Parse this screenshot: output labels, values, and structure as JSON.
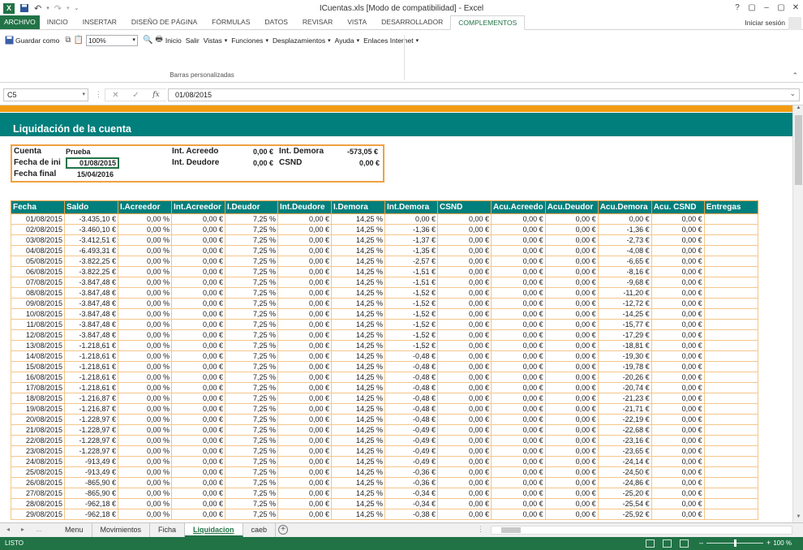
{
  "window": {
    "title": "ICuentas.xls  [Modo de compatibilidad] - Excel",
    "controls": [
      "?",
      "▢",
      "–",
      "▢",
      "✕"
    ]
  },
  "menu": {
    "tabs": [
      "ARCHIVO",
      "INICIO",
      "INSERTAR",
      "DISEÑO DE PÁGINA",
      "FÓRMULAS",
      "DATOS",
      "REVISAR",
      "VISTA",
      "DESARROLLADOR",
      "COMPLEMENTOS"
    ],
    "active_tab": "COMPLEMENTOS",
    "signin": "Iniciar sesión"
  },
  "ribbon": {
    "guardar": "Guardar como",
    "zoom": "100%",
    "inicio": "Inicio",
    "salir": "Salir",
    "vistas": "Vistas",
    "funciones": "Funciones",
    "desplazamientos": "Desplazamientos",
    "ayuda": "Ayuda",
    "enlaces": "Enlaces Internet",
    "group_label": "Barras personalizadas"
  },
  "formula_bar": {
    "name_box": "C5",
    "formula": "01/08/2015"
  },
  "sheet": {
    "title": "Liquidación de la cuenta",
    "summary": {
      "cuenta_label": "Cuenta",
      "cuenta_value": "Prueba",
      "fecha_ini_label": "Fecha de ini",
      "fecha_ini_value": "01/08/2015",
      "fecha_fin_label": "Fecha final",
      "fecha_fin_value": "15/04/2016",
      "int_acreedo_label": "Int. Acreedo",
      "int_acreedo_value": "0,00 €",
      "int_deudore_label": "Int. Deudore",
      "int_deudore_value": "0,00 €",
      "int_demora_label": "Int. Demora",
      "int_demora_value": "-573,05 €",
      "csnd_label": "CSND",
      "csnd_value": "0,00 €"
    },
    "columns": [
      "Fecha",
      "Saldo",
      "I.Acreedor",
      "Int.Acreedor",
      "I.Deudor",
      "Int.Deudore",
      "I.Demora",
      "Int.Demora",
      "CSND",
      "Acu.Acreedo",
      "Acu.Deudor",
      "Acu.Demora",
      "Acu. CSND",
      "Entregas"
    ],
    "rows": [
      [
        "01/08/2015",
        "-3.435,10 €",
        "0,00 %",
        "0,00 €",
        "7,25 %",
        "0,00 €",
        "14,25 %",
        "0,00 €",
        "0,00 €",
        "0,00 €",
        "0,00 €",
        "0,00 €",
        "0,00 €",
        ""
      ],
      [
        "02/08/2015",
        "-3.460,10 €",
        "0,00 %",
        "0,00 €",
        "7,25 %",
        "0,00 €",
        "14,25 %",
        "-1,36 €",
        "0,00 €",
        "0,00 €",
        "0,00 €",
        "-1,36 €",
        "0,00 €",
        ""
      ],
      [
        "03/08/2015",
        "-3.412,51 €",
        "0,00 %",
        "0,00 €",
        "7,25 %",
        "0,00 €",
        "14,25 %",
        "-1,37 €",
        "0,00 €",
        "0,00 €",
        "0,00 €",
        "-2,73 €",
        "0,00 €",
        ""
      ],
      [
        "04/08/2015",
        "-6.493,31 €",
        "0,00 %",
        "0,00 €",
        "7,25 %",
        "0,00 €",
        "14,25 %",
        "-1,35 €",
        "0,00 €",
        "0,00 €",
        "0,00 €",
        "-4,08 €",
        "0,00 €",
        ""
      ],
      [
        "05/08/2015",
        "-3.822,25 €",
        "0,00 %",
        "0,00 €",
        "7,25 %",
        "0,00 €",
        "14,25 %",
        "-2,57 €",
        "0,00 €",
        "0,00 €",
        "0,00 €",
        "-6,65 €",
        "0,00 €",
        ""
      ],
      [
        "06/08/2015",
        "-3.822,25 €",
        "0,00 %",
        "0,00 €",
        "7,25 %",
        "0,00 €",
        "14,25 %",
        "-1,51 €",
        "0,00 €",
        "0,00 €",
        "0,00 €",
        "-8,16 €",
        "0,00 €",
        ""
      ],
      [
        "07/08/2015",
        "-3.847,48 €",
        "0,00 %",
        "0,00 €",
        "7,25 %",
        "0,00 €",
        "14,25 %",
        "-1,51 €",
        "0,00 €",
        "0,00 €",
        "0,00 €",
        "-9,68 €",
        "0,00 €",
        ""
      ],
      [
        "08/08/2015",
        "-3.847,48 €",
        "0,00 %",
        "0,00 €",
        "7,25 %",
        "0,00 €",
        "14,25 %",
        "-1,52 €",
        "0,00 €",
        "0,00 €",
        "0,00 €",
        "-11,20 €",
        "0,00 €",
        ""
      ],
      [
        "09/08/2015",
        "-3.847,48 €",
        "0,00 %",
        "0,00 €",
        "7,25 %",
        "0,00 €",
        "14,25 %",
        "-1,52 €",
        "0,00 €",
        "0,00 €",
        "0,00 €",
        "-12,72 €",
        "0,00 €",
        ""
      ],
      [
        "10/08/2015",
        "-3.847,48 €",
        "0,00 %",
        "0,00 €",
        "7,25 %",
        "0,00 €",
        "14,25 %",
        "-1,52 €",
        "0,00 €",
        "0,00 €",
        "0,00 €",
        "-14,25 €",
        "0,00 €",
        ""
      ],
      [
        "11/08/2015",
        "-3.847,48 €",
        "0,00 %",
        "0,00 €",
        "7,25 %",
        "0,00 €",
        "14,25 %",
        "-1,52 €",
        "0,00 €",
        "0,00 €",
        "0,00 €",
        "-15,77 €",
        "0,00 €",
        ""
      ],
      [
        "12/08/2015",
        "-3.847,48 €",
        "0,00 %",
        "0,00 €",
        "7,25 %",
        "0,00 €",
        "14,25 %",
        "-1,52 €",
        "0,00 €",
        "0,00 €",
        "0,00 €",
        "-17,29 €",
        "0,00 €",
        ""
      ],
      [
        "13/08/2015",
        "-1.218,61 €",
        "0,00 %",
        "0,00 €",
        "7,25 %",
        "0,00 €",
        "14,25 %",
        "-1,52 €",
        "0,00 €",
        "0,00 €",
        "0,00 €",
        "-18,81 €",
        "0,00 €",
        ""
      ],
      [
        "14/08/2015",
        "-1.218,61 €",
        "0,00 %",
        "0,00 €",
        "7,25 %",
        "0,00 €",
        "14,25 %",
        "-0,48 €",
        "0,00 €",
        "0,00 €",
        "0,00 €",
        "-19,30 €",
        "0,00 €",
        ""
      ],
      [
        "15/08/2015",
        "-1.218,61 €",
        "0,00 %",
        "0,00 €",
        "7,25 %",
        "0,00 €",
        "14,25 %",
        "-0,48 €",
        "0,00 €",
        "0,00 €",
        "0,00 €",
        "-19,78 €",
        "0,00 €",
        ""
      ],
      [
        "16/08/2015",
        "-1.218,61 €",
        "0,00 %",
        "0,00 €",
        "7,25 %",
        "0,00 €",
        "14,25 %",
        "-0,48 €",
        "0,00 €",
        "0,00 €",
        "0,00 €",
        "-20,26 €",
        "0,00 €",
        ""
      ],
      [
        "17/08/2015",
        "-1.218,61 €",
        "0,00 %",
        "0,00 €",
        "7,25 %",
        "0,00 €",
        "14,25 %",
        "-0,48 €",
        "0,00 €",
        "0,00 €",
        "0,00 €",
        "-20,74 €",
        "0,00 €",
        ""
      ],
      [
        "18/08/2015",
        "-1.216,87 €",
        "0,00 %",
        "0,00 €",
        "7,25 %",
        "0,00 €",
        "14,25 %",
        "-0,48 €",
        "0,00 €",
        "0,00 €",
        "0,00 €",
        "-21,23 €",
        "0,00 €",
        ""
      ],
      [
        "19/08/2015",
        "-1.216,87 €",
        "0,00 %",
        "0,00 €",
        "7,25 %",
        "0,00 €",
        "14,25 %",
        "-0,48 €",
        "0,00 €",
        "0,00 €",
        "0,00 €",
        "-21,71 €",
        "0,00 €",
        ""
      ],
      [
        "20/08/2015",
        "-1.228,97 €",
        "0,00 %",
        "0,00 €",
        "7,25 %",
        "0,00 €",
        "14,25 %",
        "-0,48 €",
        "0,00 €",
        "0,00 €",
        "0,00 €",
        "-22,19 €",
        "0,00 €",
        ""
      ],
      [
        "21/08/2015",
        "-1.228,97 €",
        "0,00 %",
        "0,00 €",
        "7,25 %",
        "0,00 €",
        "14,25 %",
        "-0,49 €",
        "0,00 €",
        "0,00 €",
        "0,00 €",
        "-22,68 €",
        "0,00 €",
        ""
      ],
      [
        "22/08/2015",
        "-1.228,97 €",
        "0,00 %",
        "0,00 €",
        "7,25 %",
        "0,00 €",
        "14,25 %",
        "-0,49 €",
        "0,00 €",
        "0,00 €",
        "0,00 €",
        "-23,16 €",
        "0,00 €",
        ""
      ],
      [
        "23/08/2015",
        "-1.228,97 €",
        "0,00 %",
        "0,00 €",
        "7,25 %",
        "0,00 €",
        "14,25 %",
        "-0,49 €",
        "0,00 €",
        "0,00 €",
        "0,00 €",
        "-23,65 €",
        "0,00 €",
        ""
      ],
      [
        "24/08/2015",
        "-913,49 €",
        "0,00 %",
        "0,00 €",
        "7,25 %",
        "0,00 €",
        "14,25 %",
        "-0,49 €",
        "0,00 €",
        "0,00 €",
        "0,00 €",
        "-24,14 €",
        "0,00 €",
        ""
      ],
      [
        "25/08/2015",
        "-913,49 €",
        "0,00 %",
        "0,00 €",
        "7,25 %",
        "0,00 €",
        "14,25 %",
        "-0,36 €",
        "0,00 €",
        "0,00 €",
        "0,00 €",
        "-24,50 €",
        "0,00 €",
        ""
      ],
      [
        "26/08/2015",
        "-865,90 €",
        "0,00 %",
        "0,00 €",
        "7,25 %",
        "0,00 €",
        "14,25 %",
        "-0,36 €",
        "0,00 €",
        "0,00 €",
        "0,00 €",
        "-24,86 €",
        "0,00 €",
        ""
      ],
      [
        "27/08/2015",
        "-865,90 €",
        "0,00 %",
        "0,00 €",
        "7,25 %",
        "0,00 €",
        "14,25 %",
        "-0,34 €",
        "0,00 €",
        "0,00 €",
        "0,00 €",
        "-25,20 €",
        "0,00 €",
        ""
      ],
      [
        "28/08/2015",
        "-962,18 €",
        "0,00 %",
        "0,00 €",
        "7,25 %",
        "0,00 €",
        "14,25 %",
        "-0,34 €",
        "0,00 €",
        "0,00 €",
        "0,00 €",
        "-25,54 €",
        "0,00 €",
        ""
      ],
      [
        "29/08/2015",
        "-962,18 €",
        "0,00 %",
        "0,00 €",
        "7,25 %",
        "0,00 €",
        "14,25 %",
        "-0,38 €",
        "0,00 €",
        "0,00 €",
        "0,00 €",
        "-25,92 €",
        "0,00 €",
        ""
      ]
    ]
  },
  "sheet_tabs": [
    "Menu",
    "Movimientos",
    "Ficha",
    "Liquidacion",
    "caeb"
  ],
  "active_sheet": "Liquidacion",
  "status": {
    "ready": "LISTO",
    "zoom": "100 %"
  },
  "colors": {
    "excel_green": "#217346",
    "teal": "#007f7c",
    "orange": "#f39c12",
    "cell_border": "#f4c68a"
  }
}
